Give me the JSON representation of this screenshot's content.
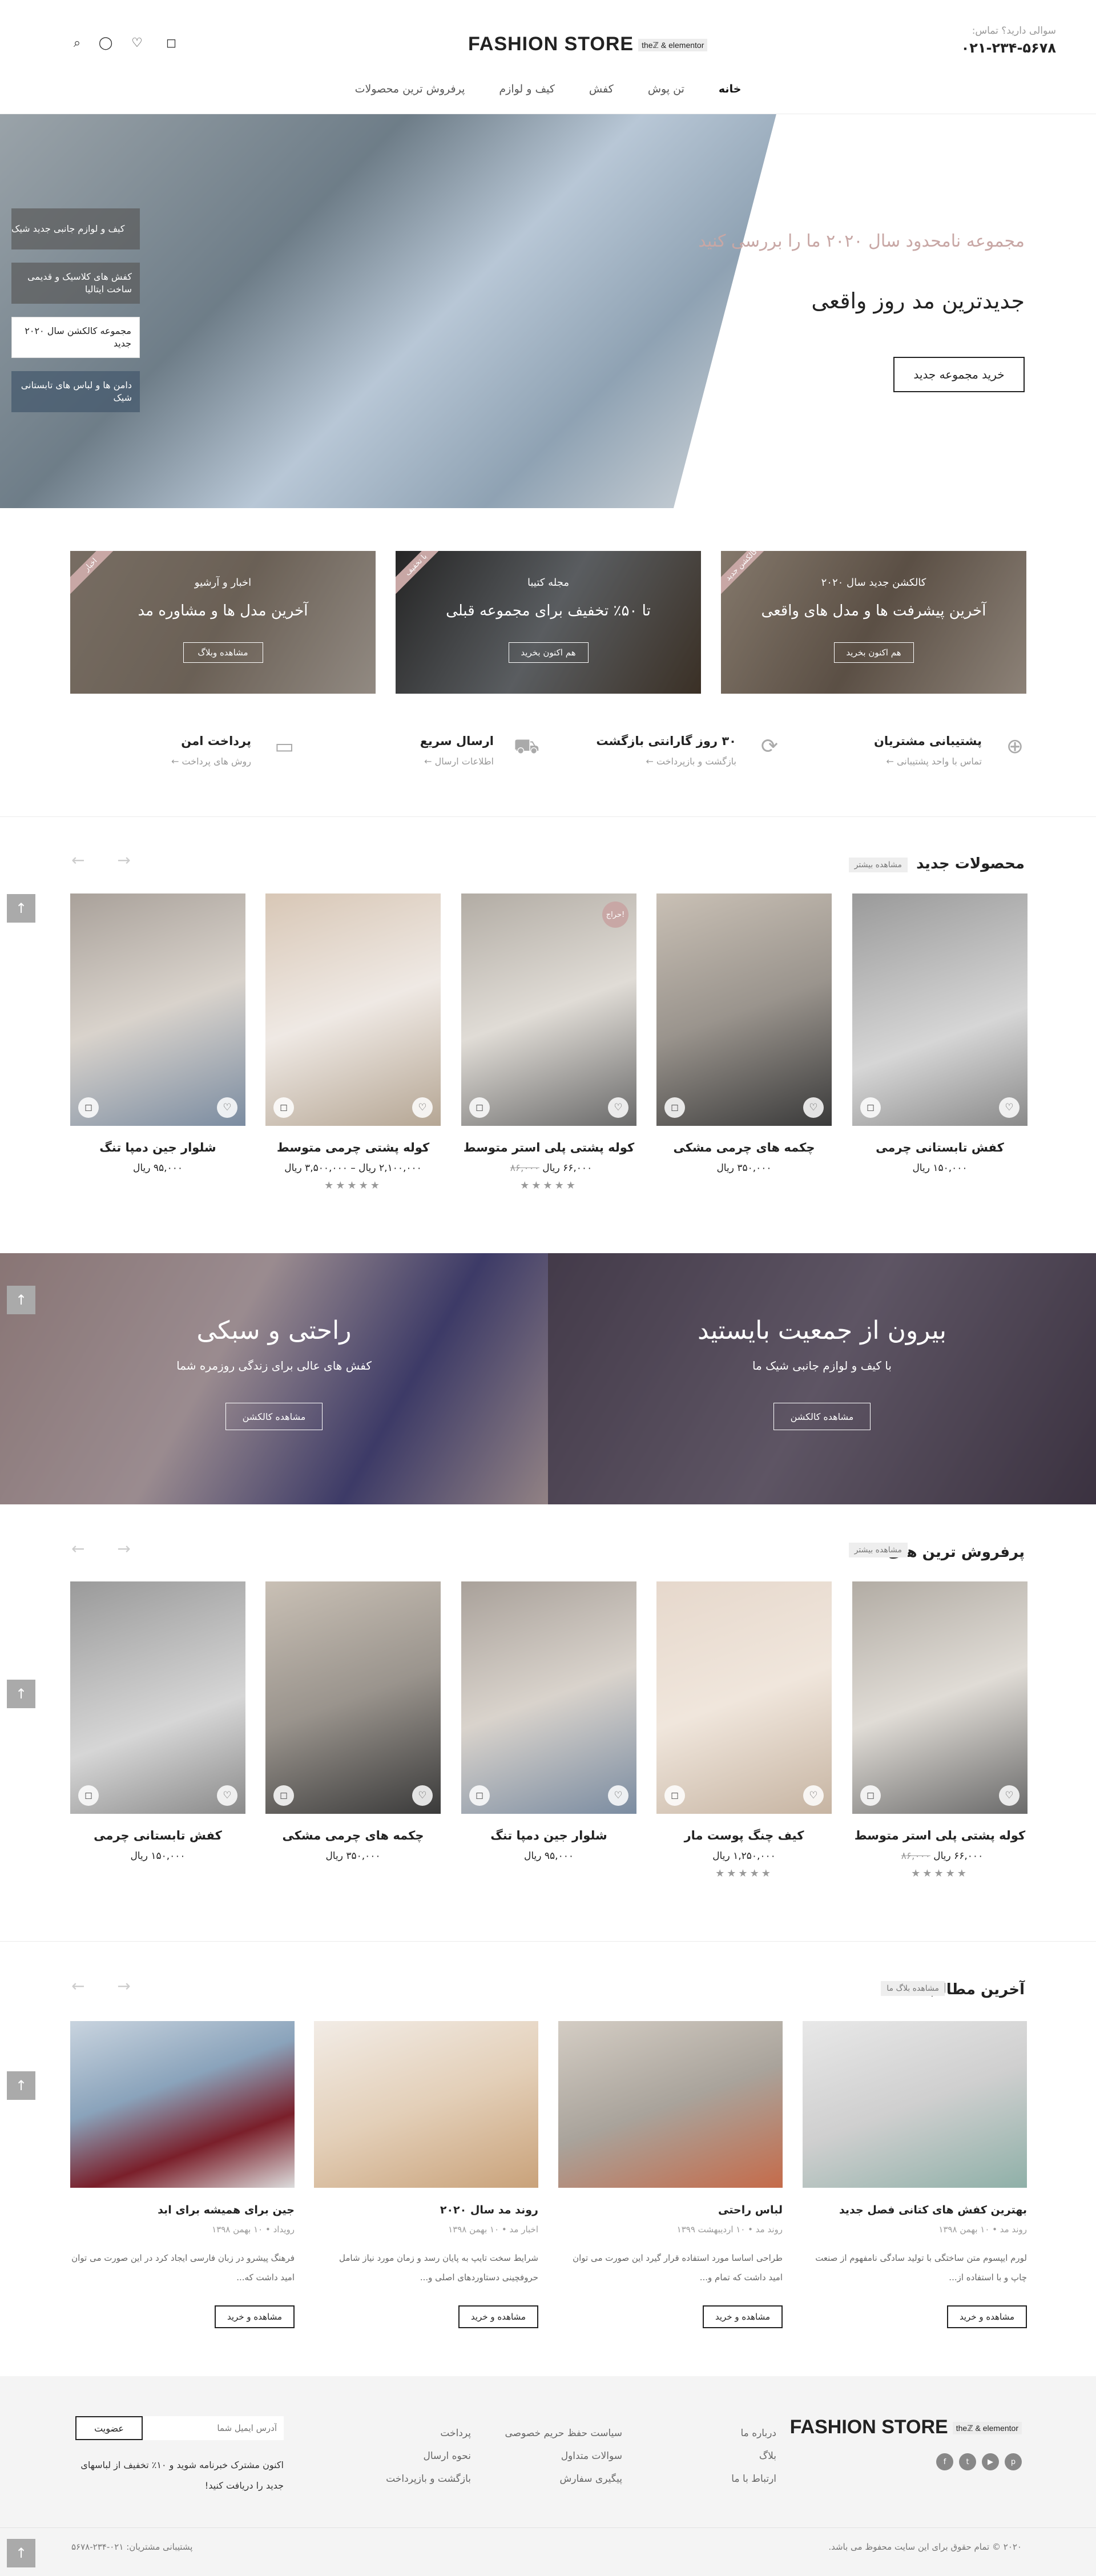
{
  "header": {
    "call_label": "سوالی دارید؟ تماس:",
    "call_number": "۰۲۱-۲۳۴-۵۶۷۸",
    "logo": "FASHION STORE",
    "logo_badge": "theℤ & elementor",
    "icons": [
      "search-icon",
      "user-icon",
      "heart-icon",
      "bag-icon"
    ],
    "nav": [
      "خانه",
      "تن پوش",
      "کفش",
      "کیف و لوازم",
      "پرفروش ترین محصولات"
    ]
  },
  "hero": {
    "subtitle": "مجموعه نامحدود سال ۲۰۲۰ ما را بررسی کنید",
    "title": "جدیدترین مد روز واقعی",
    "button": "خرید مجموعه جدید",
    "slide_tabs": [
      "کیف و لوازم جانبی جدید شیک",
      "کفش های کلاسیک و قدیمی ساخت ایتالیا",
      "مجموعه کالکشن سال ۲۰۲۰ جدید",
      "دامن ها و لباس های تابستانی شیک"
    ]
  },
  "promos": [
    {
      "ribbon": "کالکشن جدید",
      "top": "کالکشن جدید سال ۲۰۲۰",
      "headline": "آخرین پیشرفت ها و مدل های واقعی",
      "button": "هم اکنون بخرید"
    },
    {
      "ribbon": "با تخفیف",
      "top": "مجله کتیبا",
      "headline": "تا ۵۰٪ تخفیف برای مجموعه قبلی",
      "button": "هم اکنون بخرید"
    },
    {
      "ribbon": "اخبار",
      "top": "اخبار و آرشیو",
      "headline": "آخرین مدل ها و مشاوره مد",
      "button": "مشاهده وبلاگ"
    }
  ],
  "features": [
    {
      "title": "پشتیبانی مشتریان",
      "sub": "تماس با واحد پشتیبانی ←"
    },
    {
      "title": "۳۰ روز گارانتی بازگشت",
      "sub": "بازگشت و بازپرداخت ←"
    },
    {
      "title": "ارسال سریع",
      "sub": "اطلاعات ارسال ←"
    },
    {
      "title": "پرداخت امن",
      "sub": "روش های پرداخت ←"
    }
  ],
  "new_products": {
    "title": "محصولات جدید",
    "more": "مشاهده بیشتر",
    "items": [
      {
        "name": "کفش تابستانی چرمی",
        "price": "۱۵۰,۰۰۰ ریال",
        "old": "",
        "stars": ""
      },
      {
        "name": "چکمه های چرمی مشکی",
        "price": "۳۵۰,۰۰۰ ریال",
        "old": "",
        "stars": ""
      },
      {
        "name": "کوله پشتی پلی استر متوسط",
        "price": "۶۶,۰۰۰ ریال",
        "old": "۸۶,۰۰۰",
        "stars": "★★★★★",
        "sale": "حراج!"
      },
      {
        "name": "کوله پشتی چرمی متوسط",
        "price": "۲,۱۰۰,۰۰۰ ریال – ۳,۵۰۰,۰۰۰ ریال",
        "old": "",
        "stars": "★★★★★"
      },
      {
        "name": "شلوار جین دمپا تنگ",
        "price": "۹۵,۰۰۰ ریال",
        "old": "",
        "stars": ""
      }
    ]
  },
  "banners": [
    {
      "title": "بیرون از جمعیت بایستید",
      "sub": "با کیف و لوازم جانبی شیک ما",
      "button": "مشاهده کالکشن"
    },
    {
      "title": "راحتی و سبکی",
      "sub": "کفش های عالی برای زندگی روزمره شما",
      "button": "مشاهده کالکشن"
    }
  ],
  "best_sellers": {
    "title": "پرفروش ترین های ما",
    "more": "مشاهده بیشتر",
    "items": [
      {
        "name": "کوله پشتی پلی استر متوسط",
        "price": "۶۶,۰۰۰ ریال",
        "old": "۸۶,۰۰۰",
        "stars": "★★★★★"
      },
      {
        "name": "کیف چنگ پوست مار",
        "price": "۱,۲۵۰,۰۰۰ ریال",
        "old": "",
        "stars": "★★★★★"
      },
      {
        "name": "شلوار جین دمپا تنگ",
        "price": "۹۵,۰۰۰ ریال",
        "old": "",
        "stars": ""
      },
      {
        "name": "چکمه های چرمی مشکی",
        "price": "۳۵۰,۰۰۰ ریال",
        "old": "",
        "stars": ""
      },
      {
        "name": "کفش تابستانی چرمی",
        "price": "۱۵۰,۰۰۰ ریال",
        "old": "",
        "stars": ""
      }
    ]
  },
  "blog": {
    "title": "آخرین مطالب",
    "more": "مشاهده بلاگ ما",
    "posts": [
      {
        "title": "بهترین کفش های کتانی فصل جدید",
        "meta": "روند مد • ۱۰ بهمن ۱۳۹۸",
        "excerpt": "لورم ایپسوم متن ساختگی با تولید سادگی نامفهوم از صنعت چاپ و با استفاده از...",
        "button": "مشاهده و خرید"
      },
      {
        "title": "لباس راحتی",
        "meta": "روند مد • ۱۰ اردیبهشت ۱۳۹۹",
        "excerpt": "طراحی اساسا مورد استفاده قرار گیرد این صورت می توان امید داشت که تمام و...",
        "button": "مشاهده و خرید"
      },
      {
        "title": "روند مد سال ۲۰۲۰",
        "meta": "اخبار مد • ۱۰ بهمن ۱۳۹۸",
        "excerpt": "شرایط سخت تایپ به پایان رسد و زمان مورد نیاز شامل حروفچینی دستاوردهای اصلی و...",
        "button": "مشاهده و خرید"
      },
      {
        "title": "جین برای همیشه برای ابد",
        "meta": "رویداد • ۱۰ بهمن ۱۳۹۸",
        "excerpt": "فرهنگ پیشرو در زبان فارسی ایجاد کرد در این صورت می توان امید داشت که...",
        "button": "مشاهده و خرید"
      }
    ]
  },
  "footer": {
    "logo": "FASHION STORE",
    "col1": [
      "درباره ما",
      "بلاگ",
      "ارتباط با ما"
    ],
    "col2": [
      "سیاست حفظ حریم خصوصی",
      "سوالات متداول",
      "پیگیری سفارش"
    ],
    "col3": [
      "پرداخت",
      "نحوه ارسال",
      "بازگشت و بازپرداخت"
    ],
    "email_placeholder": "آدرس ایمیل شما",
    "subscribe": "عضویت",
    "promo": "اکنون مشترک خبرنامه شوید و ۱۰٪ تخفیف از لباسهای جدید را دریافت کنید!",
    "copyright": "۲۰۲۰ © تمام حقوق برای این سایت محفوظ می باشد.",
    "support": "پشتیبانی مشتریان: ۰۲۱-۲۳۴-۵۶۷۸"
  }
}
